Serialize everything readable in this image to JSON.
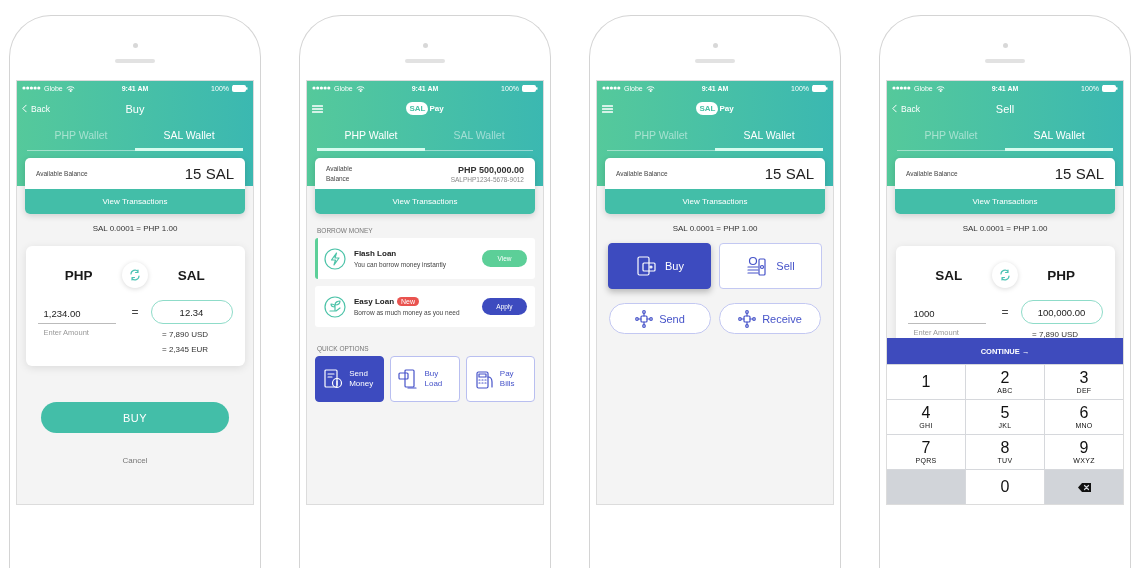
{
  "phones": [
    {
      "kind": "exchange",
      "status": {
        "carrier": "Globe",
        "time": "9:41 AM",
        "battery": "100%"
      },
      "header": {
        "back": "Back",
        "title": "Buy"
      },
      "tabs": [
        {
          "label": "PHP Wallet",
          "selected": false
        },
        {
          "label": "SAL Wallet",
          "selected": true
        }
      ],
      "balance": {
        "label": "Available Balance",
        "amount": "15 SAL",
        "action": "View Transactions"
      },
      "rate": "SAL 0.0001 = PHP 1.00",
      "converter": {
        "from": "PHP",
        "to": "SAL",
        "amount": "1,234.00",
        "hint": "Enter Amount",
        "equals": "=",
        "result": "12.34",
        "equivalents": [
          "= 7,890 USD",
          "= 2,345 EUR"
        ]
      },
      "primary_button": "BUY",
      "cancel": "Cancel"
    },
    {
      "kind": "wallet",
      "status": {
        "carrier": "Globe",
        "time": "9:41 AM",
        "battery": "100%"
      },
      "header": {
        "logo_mark": "SAL",
        "logo_text": "Pay"
      },
      "tabs": [
        {
          "label": "PHP Wallet",
          "selected": true
        },
        {
          "label": "SAL Wallet",
          "selected": false
        }
      ],
      "balance": {
        "label": "Available Balance",
        "amount": "PHP 500,000.00",
        "account": "SALPHP1234-5678-9012",
        "action": "View Transactions"
      },
      "borrow": {
        "heading": "BORROW MONEY",
        "loans": [
          {
            "title": "Flash Loan",
            "description": "You can borrow money instantly",
            "action": "View",
            "color": "#5ccf98",
            "selected": true
          },
          {
            "title": "Easy Loan",
            "tag": "New",
            "description": "Borrow as much money as you need",
            "action": "Apply",
            "color": "#3d4bbf",
            "selected": false
          }
        ]
      },
      "quick_options": {
        "heading": "QUICK OPTIONS",
        "items": [
          {
            "label": "Send Money",
            "selected": true
          },
          {
            "label": "Buy Load",
            "selected": false
          },
          {
            "label": "Pay Bills",
            "selected": false
          }
        ]
      }
    },
    {
      "kind": "sal_home",
      "status": {
        "carrier": "Globe",
        "time": "9:41 AM",
        "battery": "100%"
      },
      "header": {
        "logo_mark": "SAL",
        "logo_text": "Pay"
      },
      "tabs": [
        {
          "label": "PHP Wallet",
          "selected": false
        },
        {
          "label": "SAL Wallet",
          "selected": true
        }
      ],
      "balance": {
        "label": "Available Balance",
        "amount": "15 SAL",
        "action": "View Transactions"
      },
      "rate": "SAL 0.0001 = PHP 1.00",
      "actions": [
        {
          "label": "Buy",
          "selected": true
        },
        {
          "label": "Sell",
          "selected": false
        }
      ],
      "transfers": [
        "Send",
        "Receive"
      ]
    },
    {
      "kind": "exchange",
      "status": {
        "carrier": "Globe",
        "time": "9:41 AM",
        "battery": "100%"
      },
      "header": {
        "back": "Back",
        "title": "Sell"
      },
      "tabs": [
        {
          "label": "PHP Wallet",
          "selected": false
        },
        {
          "label": "SAL Wallet",
          "selected": true
        }
      ],
      "balance": {
        "label": "Available Balance",
        "amount": "15 SAL",
        "action": "View Transactions"
      },
      "rate": "SAL 0.0001 = PHP 1.00",
      "converter": {
        "from": "SAL",
        "to": "PHP",
        "amount": "1000",
        "hint": "Enter Amount",
        "equals": "=",
        "result": "100,000.00",
        "equivalents": [
          "= 7,890 USD"
        ]
      },
      "continue_button": "CONTINUE →",
      "keypad": [
        {
          "kind": "digit",
          "digit": "1"
        },
        {
          "kind": "digit",
          "digit": "2",
          "letters": "ABC"
        },
        {
          "kind": "digit",
          "digit": "3",
          "letters": "DEF"
        },
        {
          "kind": "digit",
          "digit": "4",
          "letters": "GHI"
        },
        {
          "kind": "digit",
          "digit": "5",
          "letters": "JKL"
        },
        {
          "kind": "digit",
          "digit": "6",
          "letters": "MNO"
        },
        {
          "kind": "digit",
          "digit": "7",
          "letters": "PQRS"
        },
        {
          "kind": "digit",
          "digit": "8",
          "letters": "TUV"
        },
        {
          "kind": "digit",
          "digit": "9",
          "letters": "WXYZ"
        },
        {
          "kind": "blank"
        },
        {
          "kind": "digit",
          "digit": "0"
        },
        {
          "kind": "delete"
        }
      ]
    }
  ]
}
